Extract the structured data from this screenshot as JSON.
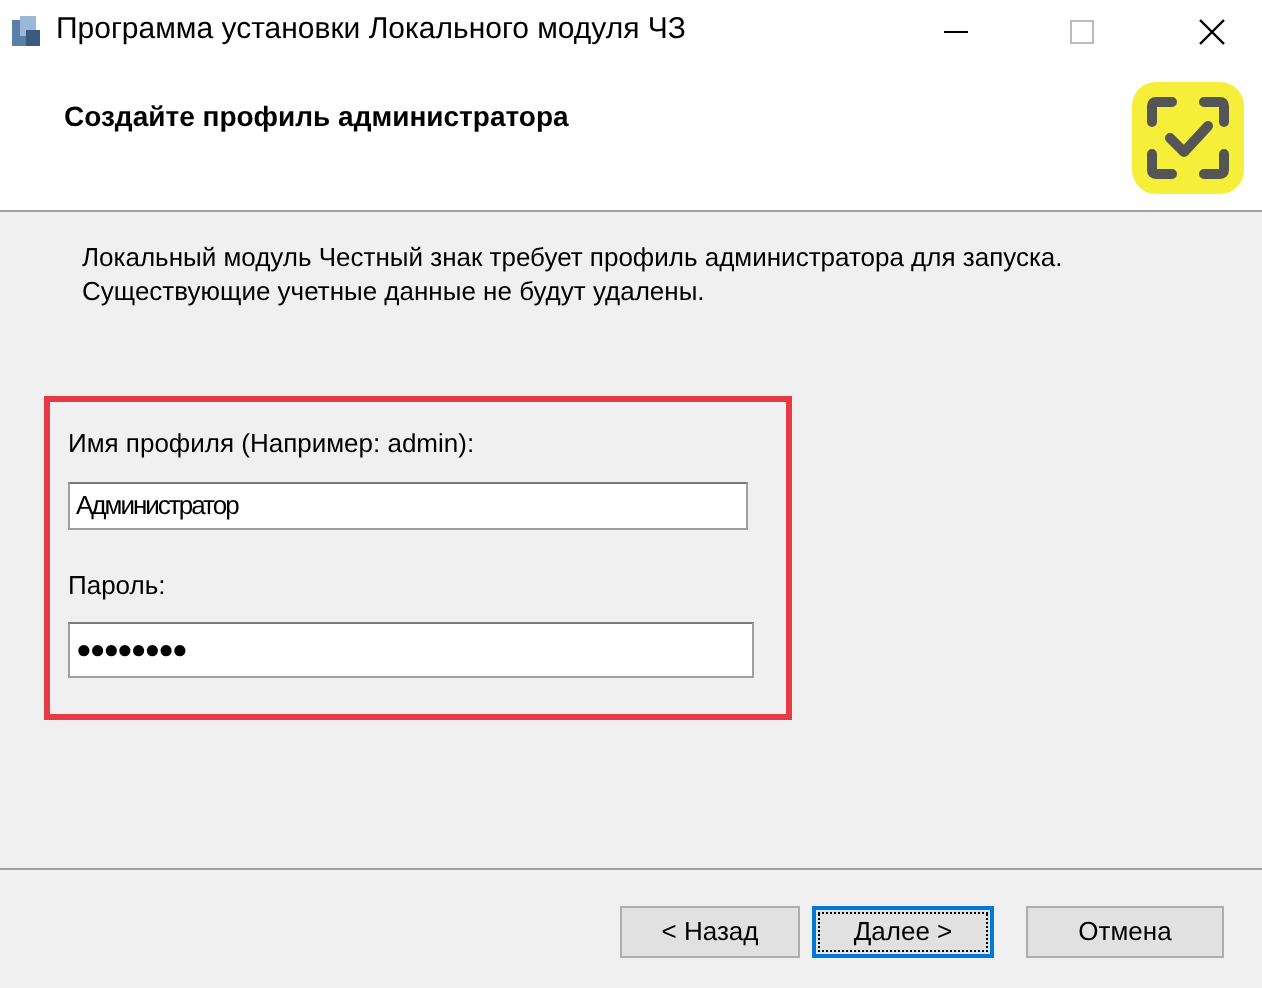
{
  "window": {
    "title": "Программа установки Локального модуля ЧЗ"
  },
  "header": {
    "title": "Создайте профиль администратора"
  },
  "description": "Локальный модуль Честный знак требует профиль администратора для запуска. Существующие учетные данные не будут удалены.",
  "fields": [
    {
      "label": "Имя профиля (Например: admin):",
      "value": "Администратор"
    },
    {
      "label": "Пароль:",
      "value": "●●●●●●●●"
    }
  ],
  "buttons": [
    {
      "label": "< Назад",
      "focused": false
    },
    {
      "label": "Далее >",
      "focused": true
    },
    {
      "label": "Отмена",
      "focused": false
    }
  ]
}
